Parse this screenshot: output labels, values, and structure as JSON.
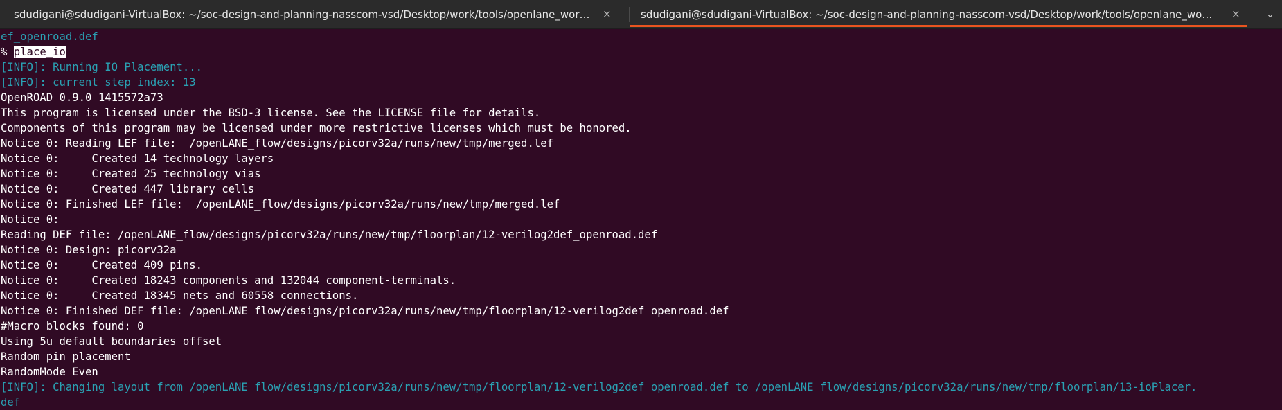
{
  "tabs": [
    {
      "title": "sdudigani@sdudigani-VirtualBox: ~/soc-design-and-planning-nasscom-vsd/Desktop/work/tools/openlane_working_dir/openlane",
      "close": "×",
      "active": false
    },
    {
      "title": "sdudigani@sdudigani-VirtualBox: ~/soc-design-and-planning-nasscom-vsd/Desktop/work/tools/openlane_working_dir/openlane",
      "close": "×",
      "active": true
    }
  ],
  "tab_menu_icon": "⌄",
  "colors": {
    "background": "#300a24",
    "info": "#2aa1b3",
    "accent": "#e95420"
  },
  "terminal": {
    "prompt_symbol": "% ",
    "command": "place_io",
    "lines": [
      {
        "text": "ef_openroad.def",
        "style": "info"
      },
      {
        "text": "[INFO]: Running IO Placement...",
        "style": "info"
      },
      {
        "text": "[INFO]: current step index: 13",
        "style": "info"
      },
      {
        "text": "OpenROAD 0.9.0 1415572a73",
        "style": "normal"
      },
      {
        "text": "This program is licensed under the BSD-3 license. See the LICENSE file for details.",
        "style": "normal"
      },
      {
        "text": "Components of this program may be licensed under more restrictive licenses which must be honored.",
        "style": "normal"
      },
      {
        "text": "Notice 0: Reading LEF file:  /openLANE_flow/designs/picorv32a/runs/new/tmp/merged.lef",
        "style": "normal"
      },
      {
        "text": "Notice 0:     Created 14 technology layers",
        "style": "normal"
      },
      {
        "text": "Notice 0:     Created 25 technology vias",
        "style": "normal"
      },
      {
        "text": "Notice 0:     Created 447 library cells",
        "style": "normal"
      },
      {
        "text": "Notice 0: Finished LEF file:  /openLANE_flow/designs/picorv32a/runs/new/tmp/merged.lef",
        "style": "normal"
      },
      {
        "text": "Notice 0:",
        "style": "normal"
      },
      {
        "text": "Reading DEF file: /openLANE_flow/designs/picorv32a/runs/new/tmp/floorplan/12-verilog2def_openroad.def",
        "style": "normal"
      },
      {
        "text": "Notice 0: Design: picorv32a",
        "style": "normal"
      },
      {
        "text": "Notice 0:     Created 409 pins.",
        "style": "normal"
      },
      {
        "text": "Notice 0:     Created 18243 components and 132044 component-terminals.",
        "style": "normal"
      },
      {
        "text": "Notice 0:     Created 18345 nets and 60558 connections.",
        "style": "normal"
      },
      {
        "text": "Notice 0: Finished DEF file: /openLANE_flow/designs/picorv32a/runs/new/tmp/floorplan/12-verilog2def_openroad.def",
        "style": "normal"
      },
      {
        "text": "#Macro blocks found: 0",
        "style": "normal"
      },
      {
        "text": "Using 5u default boundaries offset",
        "style": "normal"
      },
      {
        "text": "Random pin placement",
        "style": "normal"
      },
      {
        "text": "RandomMode Even",
        "style": "normal"
      },
      {
        "text": "[INFO]: Changing layout from /openLANE_flow/designs/picorv32a/runs/new/tmp/floorplan/12-verilog2def_openroad.def to /openLANE_flow/designs/picorv32a/runs/new/tmp/floorplan/13-ioPlacer.",
        "style": "info"
      },
      {
        "text": "def",
        "style": "info"
      }
    ]
  }
}
